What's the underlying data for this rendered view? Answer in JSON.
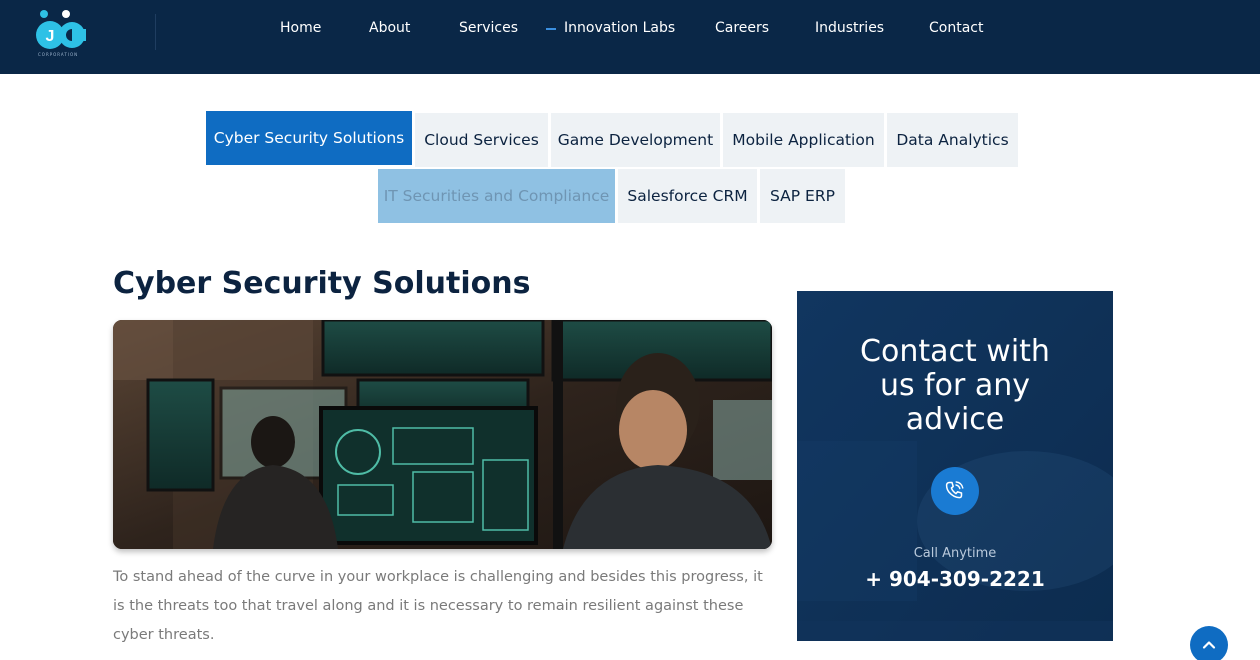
{
  "header": {
    "logo_text": "CORPORATION",
    "nav": [
      {
        "label": "Home"
      },
      {
        "label": "About"
      },
      {
        "label": "Services"
      },
      {
        "label": "Innovation Labs"
      },
      {
        "label": "Careers"
      },
      {
        "label": "Industries"
      },
      {
        "label": "Contact"
      }
    ],
    "active_nav": "Innovation Labs"
  },
  "tabs": [
    {
      "label": "Cyber Security Solutions",
      "state": "active"
    },
    {
      "label": "Cloud Services",
      "state": "default"
    },
    {
      "label": "Game Development",
      "state": "default"
    },
    {
      "label": "Mobile Application",
      "state": "default"
    },
    {
      "label": "Data Analytics",
      "state": "default"
    },
    {
      "label": "IT Securities and Compliance",
      "state": "hover"
    },
    {
      "label": "Salesforce CRM",
      "state": "default"
    },
    {
      "label": "SAP ERP",
      "state": "default"
    }
  ],
  "main": {
    "title": "Cyber Security Solutions",
    "image_icon": "cyber-security-photo",
    "paragraph": "To stand ahead of the curve in your workplace is challenging and besides this progress, it is the threats too that travel along and it is necessary to remain resilient against these cyber threats."
  },
  "contact_card": {
    "heading_line1": "Contact with",
    "heading_line2": "us for any",
    "heading_line3": "advice",
    "phone_icon": "phone-icon",
    "call_label": "Call Anytime",
    "phone_number": "+ 904-309-2221"
  },
  "scroll_top": {
    "icon": "chevron-up-icon"
  },
  "colors": {
    "header_bg": "#0a2747",
    "accent": "#0f6cc2",
    "tab_bg": "#eef2f5",
    "tab_hover_bg": "#8fc1e3",
    "title_text": "#0c2340",
    "body_text": "#7a7a7a",
    "card_bg": "#0e2d52"
  }
}
